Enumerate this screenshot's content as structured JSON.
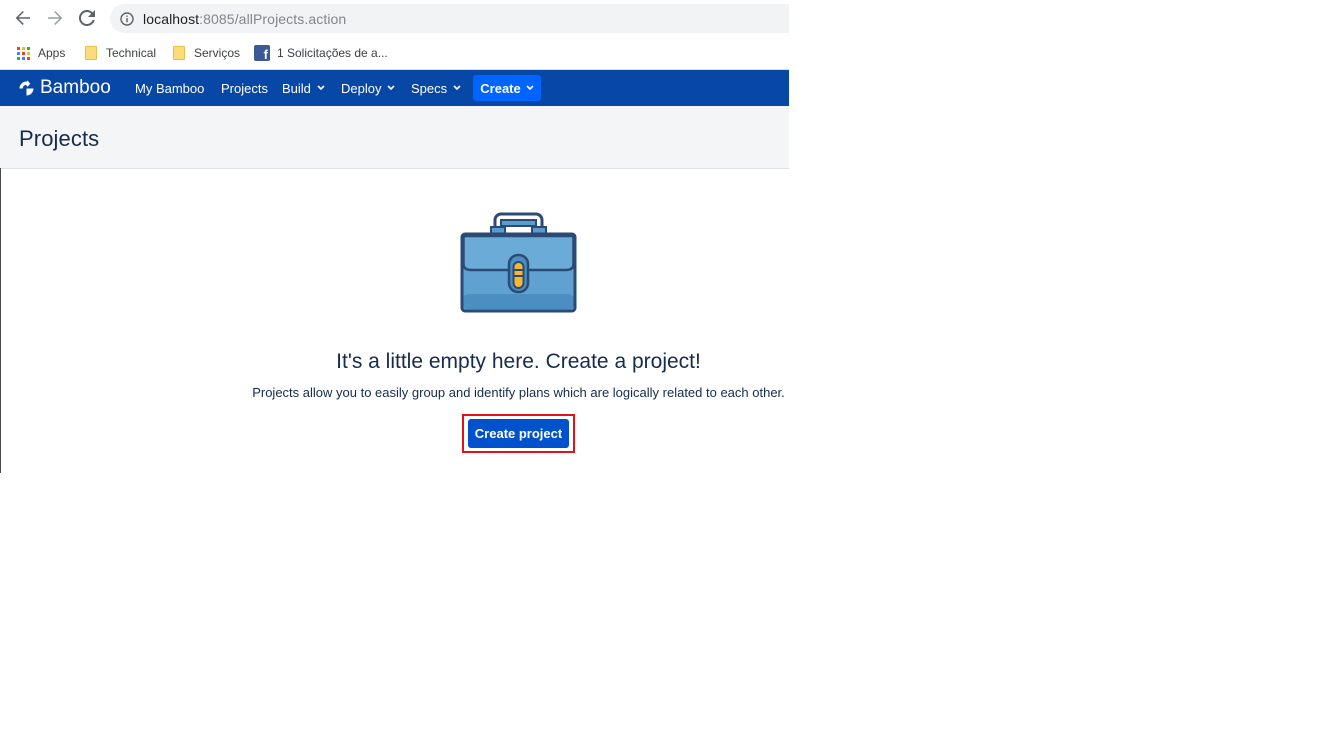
{
  "browser": {
    "url_host": "localhost",
    "url_rest": ":8085/allProjects.action",
    "bookmarks": [
      {
        "label": "Apps",
        "icon": "apps-grid-icon"
      },
      {
        "label": "Technical",
        "icon": "folder-icon"
      },
      {
        "label": "Serviços",
        "icon": "folder-icon"
      },
      {
        "label": "1 Solicitações de a...",
        "icon": "facebook-icon"
      }
    ]
  },
  "header": {
    "logo": "Bamboo",
    "nav": [
      {
        "label": "My Bamboo",
        "dropdown": false
      },
      {
        "label": "Projects",
        "dropdown": false
      },
      {
        "label": "Build",
        "dropdown": true
      },
      {
        "label": "Deploy",
        "dropdown": true
      },
      {
        "label": "Specs",
        "dropdown": true
      }
    ],
    "create_label": "Create",
    "color": "#0747a6",
    "create_color": "#0065ff"
  },
  "page": {
    "title": "Projects"
  },
  "empty_state": {
    "heading": "It's a little empty here. Create a project!",
    "description": "Projects allow you to easily group and identify plans which are logically related to each other.",
    "button_label": "Create project",
    "button_color": "#0052cc",
    "highlight_color": "#e0121c",
    "illustration": "briefcase-icon"
  }
}
